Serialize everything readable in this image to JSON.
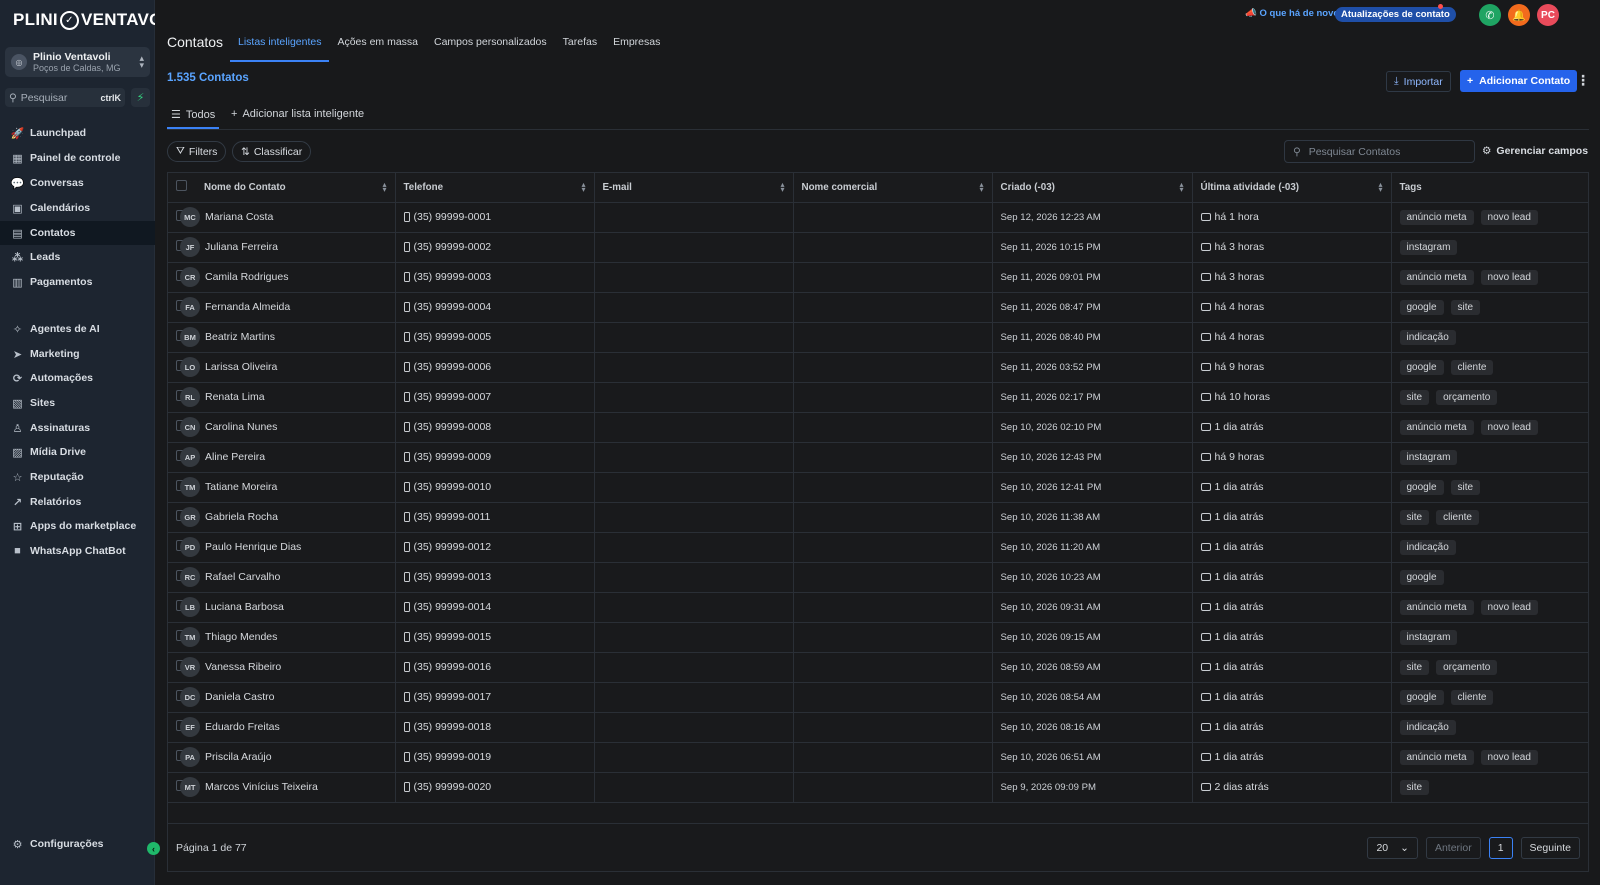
{
  "brand": {
    "name_left": "PLINI",
    "name_right": "VENTAVOLI"
  },
  "account": {
    "name": "Plinio Ventavoli",
    "location": "Poços de Caldas, MG"
  },
  "search": {
    "placeholder": "Pesquisar",
    "shortcut": "ctrlK"
  },
  "sidebar": {
    "items": [
      {
        "label": "Launchpad",
        "icon": "rocket-icon"
      },
      {
        "label": "Painel de controle",
        "icon": "dashboard-icon"
      },
      {
        "label": "Conversas",
        "icon": "chat-icon"
      },
      {
        "label": "Calendários",
        "icon": "calendar-icon"
      },
      {
        "label": "Contatos",
        "icon": "contacts-icon"
      },
      {
        "label": "Leads",
        "icon": "leads-icon"
      },
      {
        "label": "Pagamentos",
        "icon": "payments-icon"
      },
      {
        "label": "Agentes de AI",
        "icon": "ai-icon"
      },
      {
        "label": "Marketing",
        "icon": "send-icon"
      },
      {
        "label": "Automações",
        "icon": "automation-icon"
      },
      {
        "label": "Sites",
        "icon": "sites-icon"
      },
      {
        "label": "Assinaturas",
        "icon": "membership-icon"
      },
      {
        "label": "Mídia Drive",
        "icon": "media-icon"
      },
      {
        "label": "Reputação",
        "icon": "star-icon"
      },
      {
        "label": "Relatórios",
        "icon": "chart-icon"
      },
      {
        "label": "Apps do marketplace",
        "icon": "apps-icon"
      },
      {
        "label": "WhatsApp ChatBot",
        "icon": "whatsapp-icon"
      }
    ],
    "settings": "Configurações"
  },
  "header": {
    "title": "Contatos",
    "tabs": [
      "Listas inteligentes",
      "Ações em massa",
      "Campos personalizados",
      "Tarefas",
      "Empresas"
    ],
    "whats_new": "O que há de novo",
    "updates": "Atualizações de contato",
    "user_initials": "PC"
  },
  "content": {
    "count": "1.535 Contatos",
    "import": "Importar",
    "add_contact": "Adicionar Contato",
    "list_tabs": {
      "all": "Todos",
      "add": "Adicionar lista inteligente"
    },
    "filters": "Filters",
    "sort": "Classificar",
    "search_placeholder": "Pesquisar Contatos",
    "manage_fields": "Gerenciar campos"
  },
  "table": {
    "columns": [
      "Nome do Contato",
      "Telefone",
      "E-mail",
      "Nome comercial",
      "Criado (-03)",
      "Última atividade (-03)",
      "Tags"
    ],
    "rows": [
      {
        "initials": "MC",
        "name": "Mariana Costa",
        "phone": "(35) 99999-0001",
        "created": "Sep 12, 2026 12:23 AM",
        "activity": "há 1 hora",
        "tags": [
          "anúncio meta",
          "novo lead"
        ]
      },
      {
        "initials": "JF",
        "name": "Juliana Ferreira",
        "phone": "(35) 99999-0002",
        "created": "Sep 11, 2026 10:15 PM",
        "activity": "há 3 horas",
        "tags": [
          "instagram"
        ]
      },
      {
        "initials": "CR",
        "name": "Camila Rodrigues",
        "phone": "(35) 99999-0003",
        "created": "Sep 11, 2026 09:01 PM",
        "activity": "há 3 horas",
        "tags": [
          "anúncio meta",
          "novo lead"
        ]
      },
      {
        "initials": "FA",
        "name": "Fernanda Almeida",
        "phone": "(35) 99999-0004",
        "created": "Sep 11, 2026 08:47 PM",
        "activity": "há 4 horas",
        "tags": [
          "google",
          "site"
        ]
      },
      {
        "initials": "BM",
        "name": "Beatriz Martins",
        "phone": "(35) 99999-0005",
        "created": "Sep 11, 2026 08:40 PM",
        "activity": "há 4 horas",
        "tags": [
          "indicação"
        ]
      },
      {
        "initials": "LO",
        "name": "Larissa Oliveira",
        "phone": "(35) 99999-0006",
        "created": "Sep 11, 2026 03:52 PM",
        "activity": "há 9 horas",
        "tags": [
          "google",
          "cliente"
        ]
      },
      {
        "initials": "RL",
        "name": "Renata Lima",
        "phone": "(35) 99999-0007",
        "created": "Sep 11, 2026 02:17 PM",
        "activity": "há 10 horas",
        "tags": [
          "site",
          "orçamento"
        ]
      },
      {
        "initials": "CN",
        "name": "Carolina Nunes",
        "phone": "(35) 99999-0008",
        "created": "Sep 10, 2026 02:10 PM",
        "activity": "1 dia atrás",
        "tags": [
          "anúncio meta",
          "novo lead"
        ]
      },
      {
        "initials": "AP",
        "name": "Aline Pereira",
        "phone": "(35) 99999-0009",
        "created": "Sep 10, 2026 12:43 PM",
        "activity": "há 9 horas",
        "tags": [
          "instagram"
        ]
      },
      {
        "initials": "TM",
        "name": "Tatiane Moreira",
        "phone": "(35) 99999-0010",
        "created": "Sep 10, 2026 12:41 PM",
        "activity": "1 dia atrás",
        "tags": [
          "google",
          "site"
        ]
      },
      {
        "initials": "GR",
        "name": "Gabriela Rocha",
        "phone": "(35) 99999-0011",
        "created": "Sep 10, 2026 11:38 AM",
        "activity": "1 dia atrás",
        "tags": [
          "site",
          "cliente"
        ]
      },
      {
        "initials": "PD",
        "name": "Paulo Henrique Dias",
        "phone": "(35) 99999-0012",
        "created": "Sep 10, 2026 11:20 AM",
        "activity": "1 dia atrás",
        "tags": [
          "indicação"
        ]
      },
      {
        "initials": "RC",
        "name": "Rafael Carvalho",
        "phone": "(35) 99999-0013",
        "created": "Sep 10, 2026 10:23 AM",
        "activity": "1 dia atrás",
        "tags": [
          "google"
        ]
      },
      {
        "initials": "LB",
        "name": "Luciana Barbosa",
        "phone": "(35) 99999-0014",
        "created": "Sep 10, 2026 09:31 AM",
        "activity": "1 dia atrás",
        "tags": [
          "anúncio meta",
          "novo lead"
        ]
      },
      {
        "initials": "TM",
        "name": "Thiago Mendes",
        "phone": "(35) 99999-0015",
        "created": "Sep 10, 2026 09:15 AM",
        "activity": "1 dia atrás",
        "tags": [
          "instagram"
        ]
      },
      {
        "initials": "VR",
        "name": "Vanessa Ribeiro",
        "phone": "(35) 99999-0016",
        "created": "Sep 10, 2026 08:59 AM",
        "activity": "1 dia atrás",
        "tags": [
          "site",
          "orçamento"
        ]
      },
      {
        "initials": "DC",
        "name": "Daniela Castro",
        "phone": "(35) 99999-0017",
        "created": "Sep 10, 2026 08:54 AM",
        "activity": "1 dia atrás",
        "tags": [
          "google",
          "cliente"
        ]
      },
      {
        "initials": "EF",
        "name": "Eduardo Freitas",
        "phone": "(35) 99999-0018",
        "created": "Sep 10, 2026 08:16 AM",
        "activity": "1 dia atrás",
        "tags": [
          "indicação"
        ]
      },
      {
        "initials": "PA",
        "name": "Priscila Araújo",
        "phone": "(35) 99999-0019",
        "created": "Sep 10, 2026 06:51 AM",
        "activity": "1 dia atrás",
        "tags": [
          "anúncio meta",
          "novo lead"
        ]
      },
      {
        "initials": "MT",
        "name": "Marcos Vinícius Teixeira",
        "phone": "(35) 99999-0020",
        "created": "Sep 9, 2026 09:09 PM",
        "activity": "2 dias atrás",
        "tags": [
          "site"
        ]
      }
    ]
  },
  "pagination": {
    "info": "Página 1 de 77",
    "page_size": "20",
    "prev": "Anterior",
    "current": "1",
    "next": "Seguinte"
  },
  "colors": {
    "accent": "#3b82f6",
    "accent_text": "#5aa4ff",
    "phone_btn": "#1fa463",
    "bell_btn": "#f26b1d",
    "avatar_btn": "#e94b5b"
  }
}
